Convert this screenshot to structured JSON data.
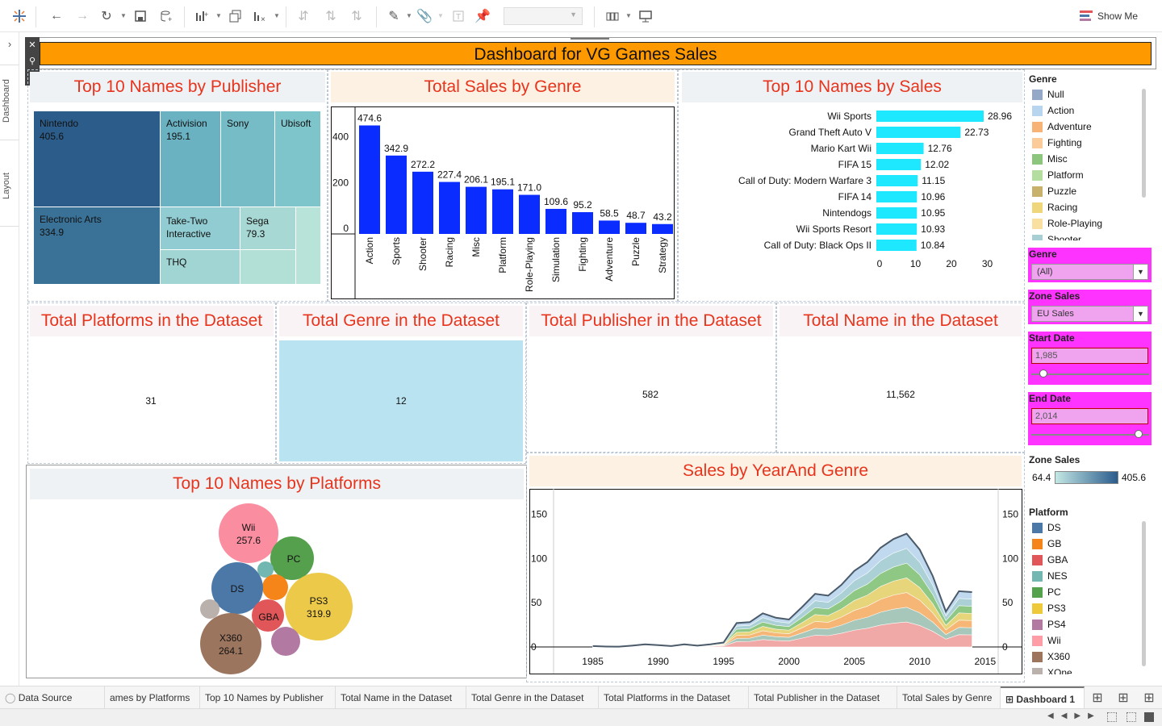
{
  "toolbar": {
    "show_me_label": "Show Me",
    "colors": {
      "accent": "#1f77b4"
    }
  },
  "left_rail": {
    "tabs": [
      "Dashboard",
      "Layout"
    ]
  },
  "dashboard": {
    "title": "Dashboard for VG Games Sales",
    "panels": {
      "publisher": {
        "title": "Top 10 Names by Publisher",
        "cells": [
          {
            "name": "Nintendo",
            "value": "405.6",
            "color": "#2c5d8a"
          },
          {
            "name": "Electronic Arts",
            "value": "334.9",
            "color": "#3a7196"
          },
          {
            "name": "Activision",
            "value": "195.1",
            "color": "#6ab1c2"
          },
          {
            "name": "Sony",
            "value": "",
            "color": "#75bcc7"
          },
          {
            "name": "Ubisoft",
            "value": "",
            "color": "#7ec4cb"
          },
          {
            "name": "Take-Two Interactive",
            "value": "",
            "color": "#90ccd1"
          },
          {
            "name": "Sega",
            "value": "79.3",
            "color": "#a7d8d4"
          },
          {
            "name": "THQ",
            "value": "",
            "color": "#a1d5d3"
          }
        ]
      },
      "genre_sales": {
        "title": "Total Sales by Genre"
      },
      "name_sales": {
        "title": "Top 10 Names by Sales"
      },
      "kpis": [
        {
          "title": "Total Platforms in the Dataset",
          "value": "31"
        },
        {
          "title": "Total Genre in the Dataset",
          "value": "12"
        },
        {
          "title": "Total Publisher in the Dataset",
          "value": "582"
        },
        {
          "title": "Total Name in the Dataset",
          "value": "11,562"
        }
      ],
      "platforms": {
        "title": "Top 10 Names by Platforms",
        "bubbles": [
          {
            "label": "Wii",
            "value": "257.6",
            "color": "#fa8ea0"
          },
          {
            "label": "PC",
            "value": "",
            "color": "#55a04d"
          },
          {
            "label": "DS",
            "value": "",
            "color": "#4c78a8"
          },
          {
            "label": "PS3",
            "value": "319.9",
            "color": "#ecc948"
          },
          {
            "label": "GBA",
            "value": "",
            "color": "#e15759"
          },
          {
            "label": "X360",
            "value": "264.1",
            "color": "#9c755f"
          }
        ]
      },
      "year_genre": {
        "title": "Sales by YearAnd Genre"
      }
    }
  },
  "filters": {
    "genre_legend_title": "Genre",
    "genre_legend": [
      {
        "label": "Null",
        "color": "#94a9c7"
      },
      {
        "label": "Action",
        "color": "#b8d5ef"
      },
      {
        "label": "Adventure",
        "color": "#f7b276"
      },
      {
        "label": "Fighting",
        "color": "#fbcc9a"
      },
      {
        "label": "Misc",
        "color": "#8cc57c"
      },
      {
        "label": "Platform",
        "color": "#b3dea0"
      },
      {
        "label": "Puzzle",
        "color": "#c8b26b"
      },
      {
        "label": "Racing",
        "color": "#efd67a"
      },
      {
        "label": "Role-Playing",
        "color": "#f9dfa0"
      },
      {
        "label": "Shooter",
        "color": "#a8cfd3"
      }
    ],
    "genre_filter": {
      "label": "Genre",
      "value": "(All)"
    },
    "zone_filter": {
      "label": "Zone Sales",
      "value": "EU Sales"
    },
    "start_date": {
      "label": "Start Date",
      "value": "1,985",
      "position": 0.1
    },
    "end_date": {
      "label": "End Date",
      "value": "2,014",
      "position": 0.91
    },
    "zone_scale": {
      "label": "Zone Sales",
      "min": "64.4",
      "max": "405.6"
    },
    "platform_legend_title": "Platform",
    "platform_legend": [
      {
        "label": "DS",
        "color": "#4c78a8"
      },
      {
        "label": "GB",
        "color": "#f58518"
      },
      {
        "label": "GBA",
        "color": "#e15759"
      },
      {
        "label": "NES",
        "color": "#72b7b2"
      },
      {
        "label": "PC",
        "color": "#54a24b"
      },
      {
        "label": "PS3",
        "color": "#eeca3b"
      },
      {
        "label": "PS4",
        "color": "#b279a2"
      },
      {
        "label": "Wii",
        "color": "#ff9da6"
      },
      {
        "label": "X360",
        "color": "#9d755d"
      },
      {
        "label": "XOne",
        "color": "#bab0ac"
      }
    ]
  },
  "tabs": [
    "Data Source",
    "ames by Platforms",
    "Top 10 Names by Publisher",
    "Total Name in the Dataset",
    "Total Genre in the Dataset",
    "Total Platforms in the Dataset",
    "Total Publisher in the Dataset",
    "Total Sales by Genre",
    "Dashboard 1"
  ],
  "chart_data": [
    {
      "type": "bar",
      "title": "Total Sales by Genre",
      "categories": [
        "Action",
        "Sports",
        "Shooter",
        "Racing",
        "Misc",
        "Platform",
        "Role-Playing",
        "Simulation",
        "Fighting",
        "Adventure",
        "Puzzle",
        "Strategy"
      ],
      "values": [
        474.6,
        342.9,
        272.2,
        227.4,
        206.1,
        195.1,
        171.0,
        109.6,
        95.2,
        58.5,
        48.7,
        43.2
      ],
      "labels": [
        "474.6",
        "342.9",
        "272.2",
        "227.4",
        "206.1",
        "195.1",
        "171.0",
        "109.6",
        "95.2",
        "58.5",
        "48.7",
        "43.2"
      ],
      "yticks": [
        "0",
        "200",
        "400"
      ],
      "ylim": [
        0,
        500
      ],
      "color": "#0a2cff"
    },
    {
      "type": "bar",
      "orientation": "horizontal",
      "title": "Top 10 Names by Sales",
      "categories": [
        "Wii Sports",
        "Grand Theft Auto V",
        "Mario Kart Wii",
        "FIFA 15",
        "Call of Duty: Modern Warfare 3",
        "FIFA 14",
        "Nintendogs",
        "Wii Sports Resort",
        "Call of Duty: Black Ops II"
      ],
      "values": [
        28.96,
        22.73,
        12.76,
        12.02,
        11.15,
        10.96,
        10.95,
        10.93,
        10.84
      ],
      "labels": [
        "28.96",
        "22.73",
        "12.76",
        "12.02",
        "11.15",
        "10.96",
        "10.95",
        "10.93",
        "10.84"
      ],
      "xticks": [
        "0",
        "10",
        "20",
        "30"
      ],
      "xlim": [
        0,
        30
      ],
      "color": "#1ee8ff"
    },
    {
      "type": "area",
      "title": "Sales by YearAnd Genre",
      "x": [
        1985,
        1986,
        1987,
        1988,
        1989,
        1990,
        1991,
        1992,
        1993,
        1994,
        1995,
        1996,
        1997,
        1998,
        1999,
        2000,
        2001,
        2002,
        2003,
        2004,
        2005,
        2006,
        2007,
        2008,
        2009,
        2010,
        2011,
        2012,
        2013,
        2014
      ],
      "total": [
        1,
        0.5,
        0.3,
        1.5,
        3,
        2,
        1,
        3,
        1.5,
        3,
        5,
        27,
        28,
        38,
        33,
        31,
        45,
        60,
        58,
        70,
        86,
        96,
        112,
        122,
        128,
        110,
        80,
        40,
        63,
        62
      ],
      "xticks": [
        "1985",
        "1990",
        "1995",
        "2000",
        "2005",
        "2010",
        "2015"
      ],
      "yticks": [
        "0",
        "50",
        "100",
        "150"
      ],
      "ylim": [
        0,
        175
      ],
      "xlim": [
        1982,
        2016
      ]
    }
  ]
}
